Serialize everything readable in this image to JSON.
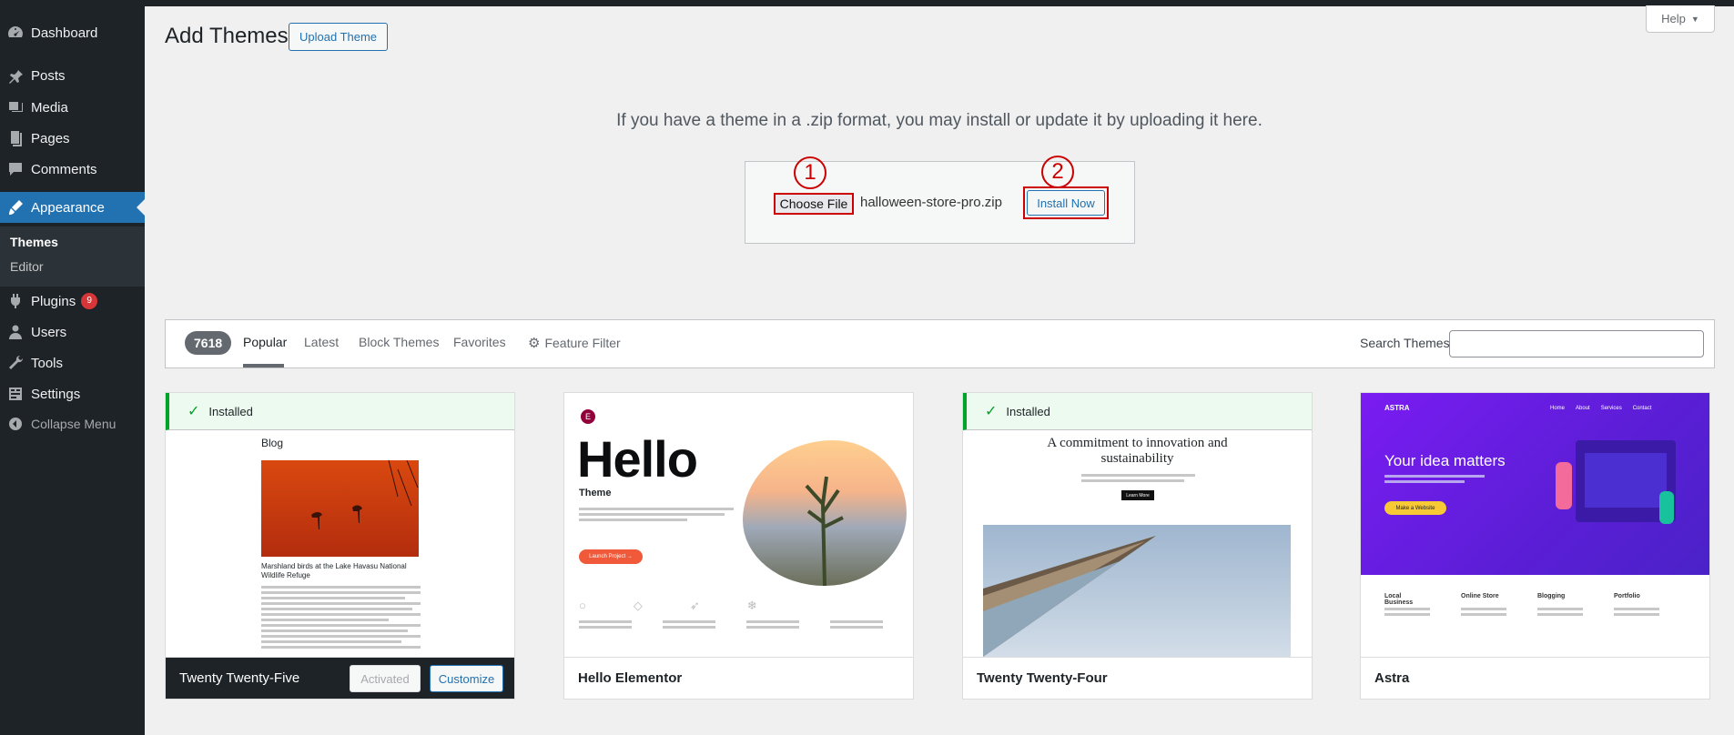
{
  "sidebar": {
    "items": [
      {
        "label": "Dashboard",
        "icon": "dashboard-icon"
      },
      {
        "label": "Posts",
        "icon": "pin-icon"
      },
      {
        "label": "Media",
        "icon": "media-icon"
      },
      {
        "label": "Pages",
        "icon": "pages-icon"
      },
      {
        "label": "Comments",
        "icon": "comments-icon"
      },
      {
        "label": "Appearance",
        "icon": "paintbrush-icon",
        "active": true
      },
      {
        "label": "Plugins",
        "icon": "plugins-icon",
        "badge": "9"
      },
      {
        "label": "Users",
        "icon": "users-icon"
      },
      {
        "label": "Tools",
        "icon": "tools-icon"
      },
      {
        "label": "Settings",
        "icon": "settings-icon"
      }
    ],
    "submenu": [
      "Themes",
      "Editor"
    ],
    "collapse_label": "Collapse Menu"
  },
  "header": {
    "title": "Add Themes",
    "upload_button": "Upload Theme",
    "help_button": "Help"
  },
  "upload": {
    "instructions": "If you have a theme in a .zip format, you may install or update it by uploading it here.",
    "choose_file_label": "Choose File",
    "file_name": "halloween-store-pro.zip",
    "install_button": "Install Now",
    "markers": [
      "1",
      "2"
    ],
    "marker_color": "#cc0000"
  },
  "filter": {
    "count": "7618",
    "tabs": [
      "Popular",
      "Latest",
      "Block Themes",
      "Favorites"
    ],
    "feature_filter": "Feature Filter",
    "search_label": "Search Themes",
    "search_value": ""
  },
  "themes": [
    {
      "name": "Twenty Twenty-Five",
      "installed_label": "Installed",
      "activated_label": "Activated",
      "customize_label": "Customize",
      "preview": {
        "heading": "Blog",
        "caption": "Marshland birds at the Lake Havasu National Wildlife Refuge"
      }
    },
    {
      "name": "Hello Elementor",
      "preview": {
        "big": "Hello",
        "sub": "Theme",
        "cta": "Launch Project →"
      }
    },
    {
      "name": "Twenty Twenty-Four",
      "installed_label": "Installed",
      "preview": {
        "headline": "A commitment to innovation and sustainability",
        "button": "Learn More"
      }
    },
    {
      "name": "Astra",
      "preview": {
        "logo": "ASTRA",
        "nav": [
          "Home",
          "About",
          "Services",
          "Contact"
        ],
        "headline": "Your idea matters",
        "button": "Make a Website",
        "features": [
          "Local Business",
          "Online Store",
          "Blogging",
          "Portfolio"
        ]
      }
    }
  ],
  "colors": {
    "accent": "#2271b1",
    "sidebar_bg": "#1d2327",
    "installed_green": "#00a32a"
  }
}
